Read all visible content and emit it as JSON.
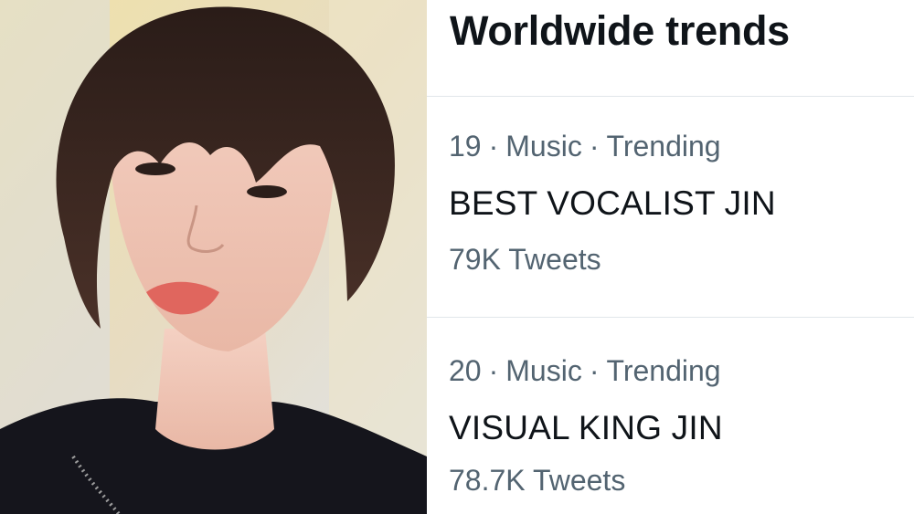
{
  "photo": {
    "icon": "portrait-photo"
  },
  "trends": {
    "title": "Worldwide trends",
    "items": [
      {
        "rank": "19",
        "category": "Music",
        "status": "Trending",
        "name": "BEST VOCALIST JIN",
        "count": "79K Tweets"
      },
      {
        "rank": "20",
        "category": "Music",
        "status": "Trending",
        "name": "VISUAL KING JIN",
        "count": "78.7K Tweets"
      }
    ],
    "separator": "·"
  },
  "colors": {
    "title": "#0f1419",
    "secondary_text": "#536471",
    "divider": "#e1e6ea"
  }
}
